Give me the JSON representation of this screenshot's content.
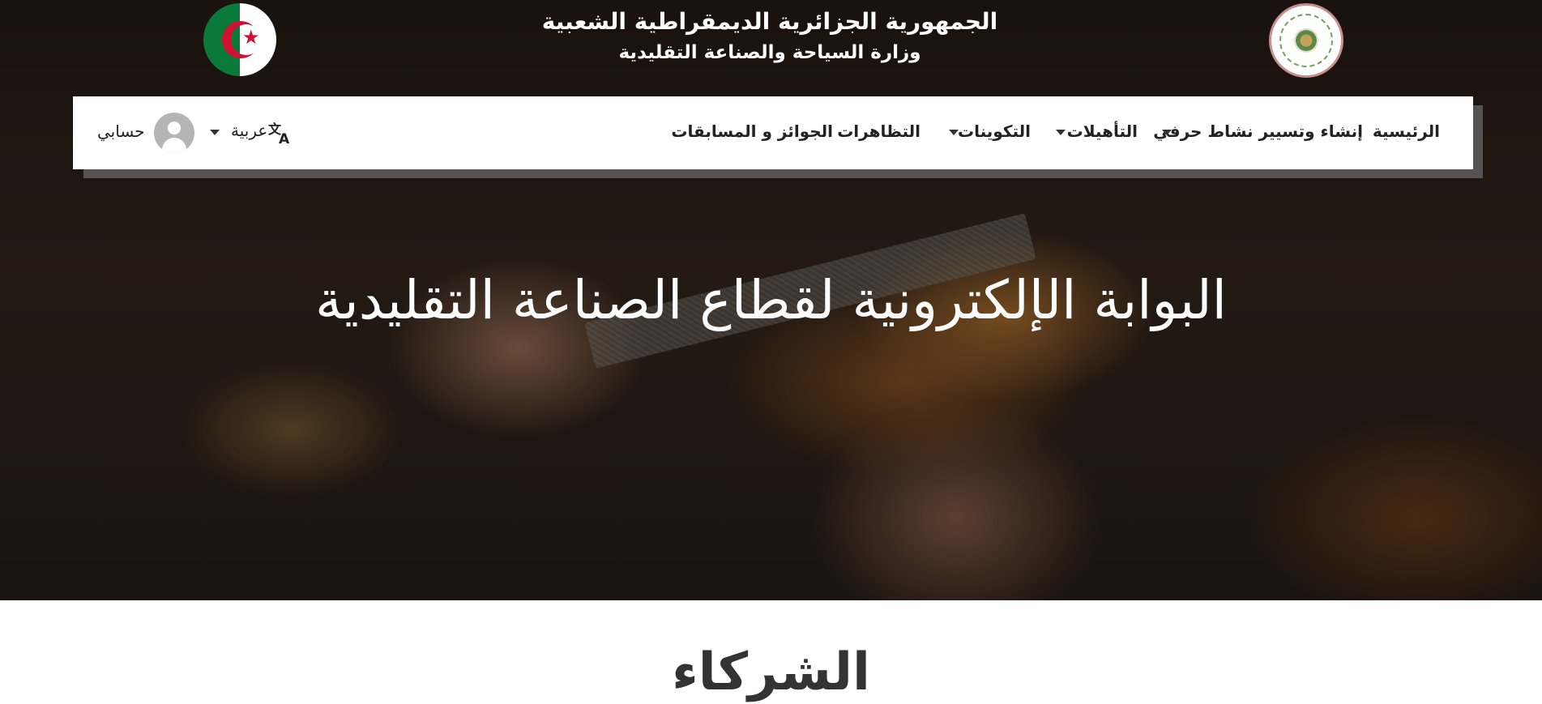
{
  "header": {
    "republic": "الجمهورية الجزائرية الديمقراطية الشعبية",
    "ministry": "وزارة السياحة والصناعة التقليدية",
    "flag_icon": "algerian-flag-icon",
    "logo_icon": "ministry-emblem-icon"
  },
  "nav": {
    "items": [
      {
        "label": "الرئيسية",
        "has_dropdown": false
      },
      {
        "label": "إنشاء وتسيير نشاط حرفي",
        "has_dropdown": true
      },
      {
        "label": "التأهيلات",
        "has_dropdown": true
      },
      {
        "label": "التكوينات",
        "has_dropdown": true
      },
      {
        "label": "التظاهرات",
        "has_dropdown": false
      },
      {
        "label": "الجوائز و المسابقات",
        "has_dropdown": false
      }
    ],
    "language": "عربية",
    "account": "حسابي"
  },
  "hero": {
    "title": "البوابة الإلكترونية لقطاع الصناعة التقليدية"
  },
  "partners": {
    "title": "الشركاء"
  },
  "colors": {
    "navbar_bg": "#ffffff",
    "text_dark": "#222222",
    "flag_green": "#0a7a3a",
    "flag_red": "#d21034"
  }
}
